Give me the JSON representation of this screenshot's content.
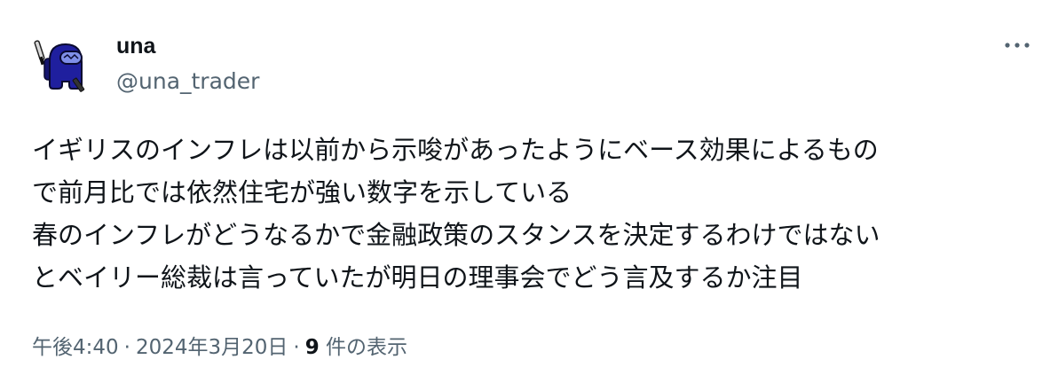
{
  "author": {
    "display_name": "una",
    "handle": "@una_trader",
    "avatar_icon": "impostor-crewmate-avatar"
  },
  "more_menu_icon": "more-horizontal-icon",
  "tweet": {
    "lines": [
      "イギリスのインフレは以前から示唆があったようにベース効果によるもの",
      "で前月比では依然住宅が強い数字を示している",
      "春のインフレがどうなるかで金融政策のスタンスを決定するわけではない",
      "とベイリー総裁は言っていたが明日の理事会でどう言及するか注目"
    ]
  },
  "meta": {
    "time": "午後4:40",
    "separator": "·",
    "date": "2024年3月20日",
    "views_count": "9",
    "views_label": " 件の表示"
  },
  "colors": {
    "text_primary": "#0f1419",
    "text_secondary": "#536471",
    "avatar_body": "#1f1f9e",
    "avatar_visor": "#7f8fe8"
  }
}
